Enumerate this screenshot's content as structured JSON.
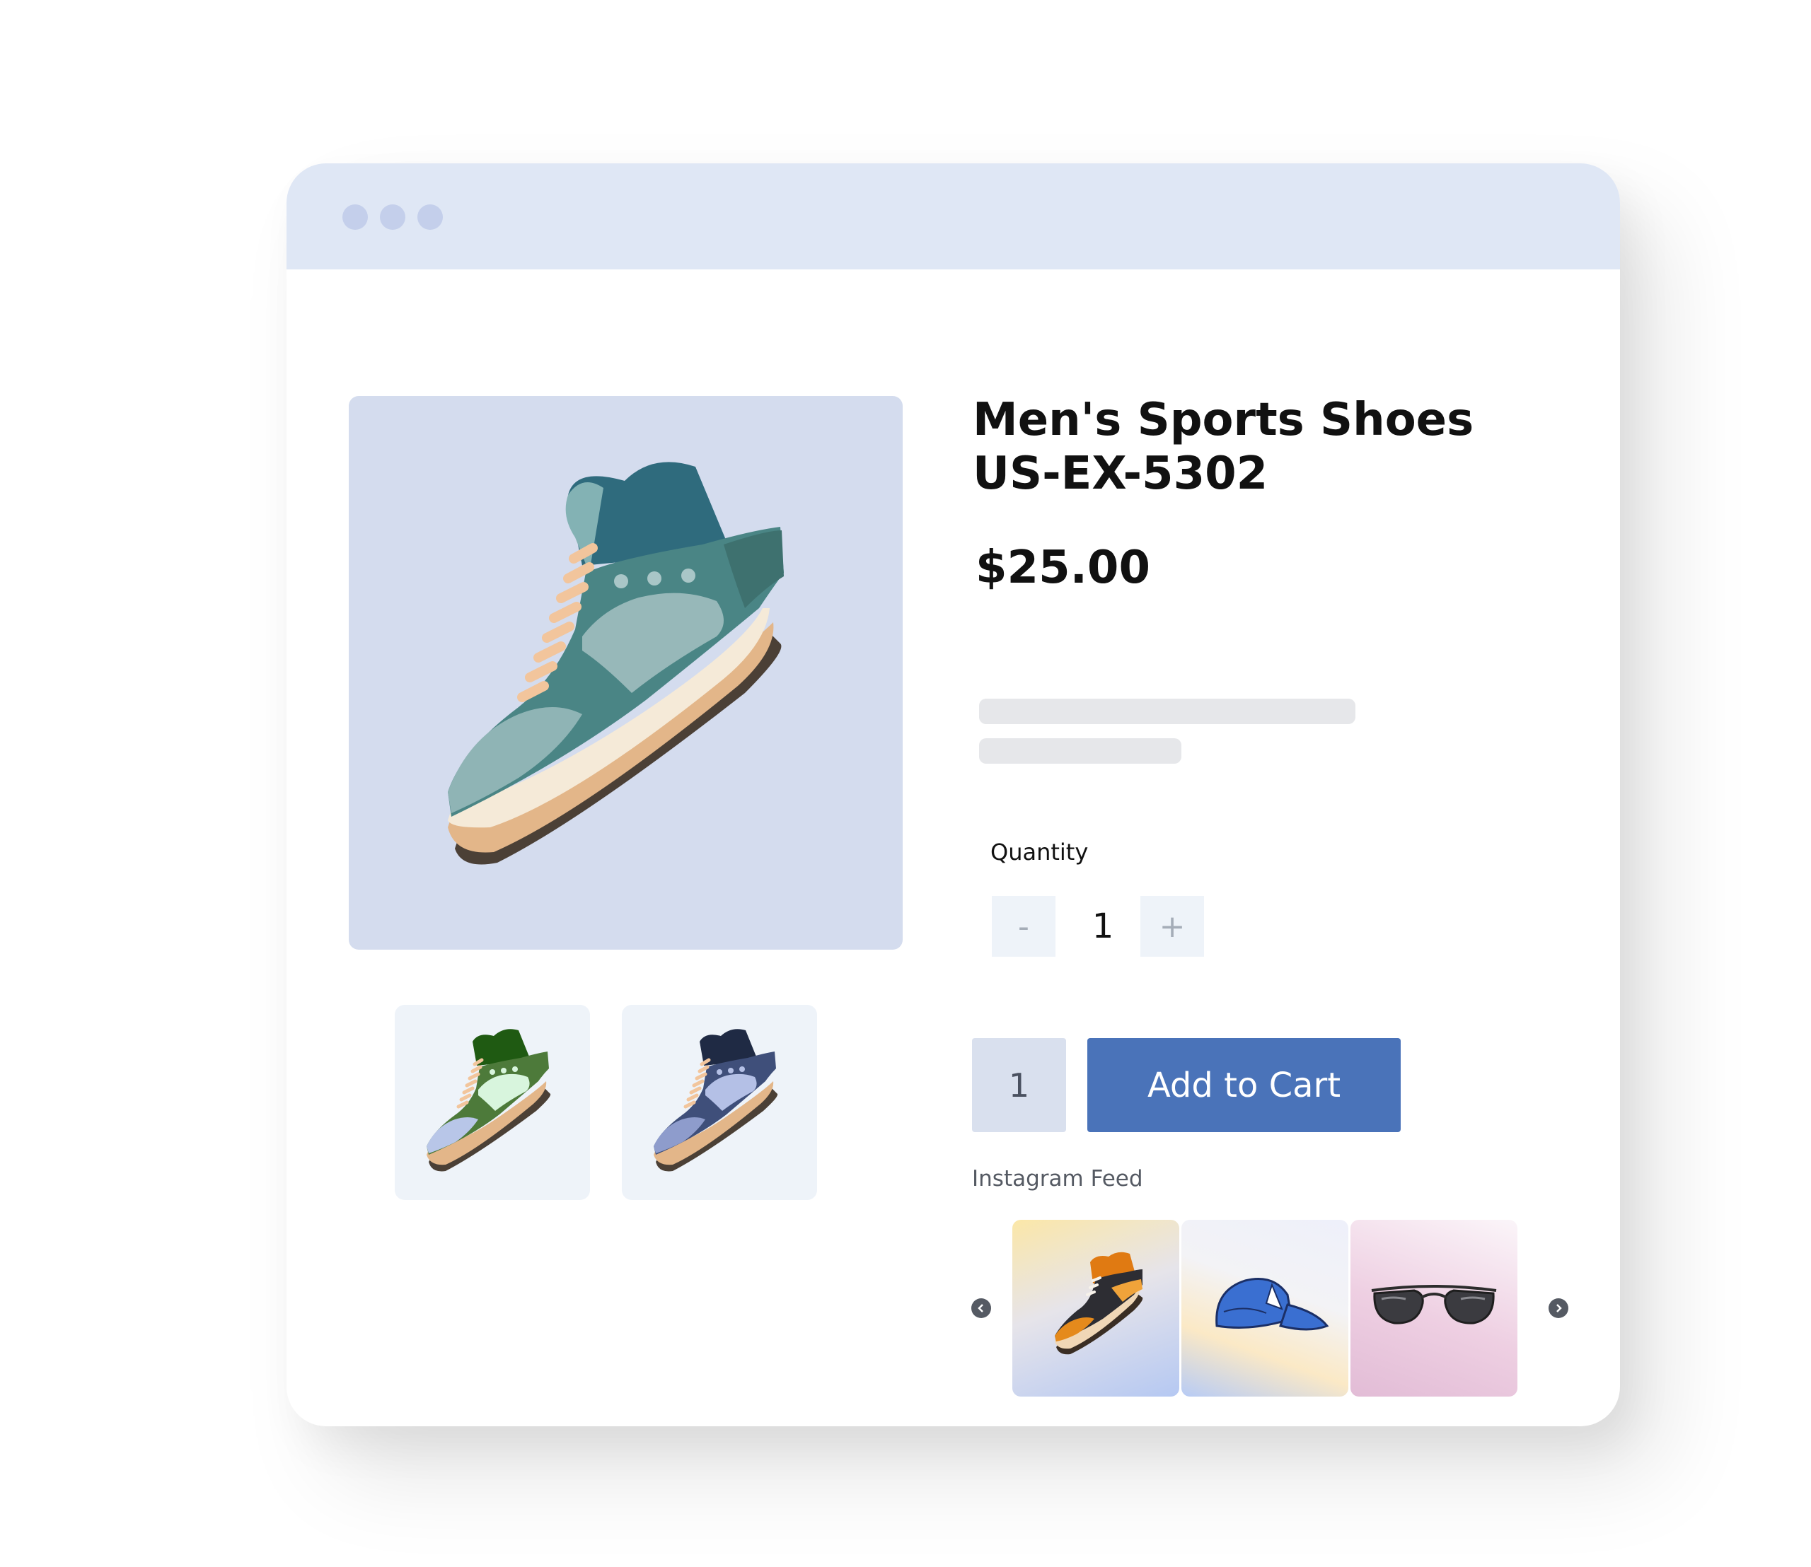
{
  "window": {
    "controls": [
      "window-dot",
      "window-dot",
      "window-dot"
    ]
  },
  "product": {
    "title_line1": "Men's Sports Shoes",
    "title_line2": "US-EX-5302",
    "price": "$25.00",
    "main_image_icon": "teal-sneaker-icon",
    "thumbnails": [
      {
        "icon": "green-sneaker-icon"
      },
      {
        "icon": "navy-sneaker-icon"
      }
    ]
  },
  "quantity": {
    "label": "Quantity",
    "decrement": "-",
    "value": "1",
    "increment": "+"
  },
  "cart": {
    "quantity_value": "1",
    "add_button_label": "Add to Cart"
  },
  "instagram": {
    "label": "Instagram Feed",
    "prev_icon": "arrow-left-icon",
    "next_icon": "arrow-right-icon",
    "items": [
      {
        "icon": "orange-sneaker-icon"
      },
      {
        "icon": "blue-cap-icon"
      },
      {
        "icon": "sunglasses-icon"
      }
    ]
  },
  "colors": {
    "titlebar": "#dfe7f5",
    "main_image_bg": "#d4dcee",
    "accent_button": "#4a73b9",
    "text": "#111111"
  }
}
